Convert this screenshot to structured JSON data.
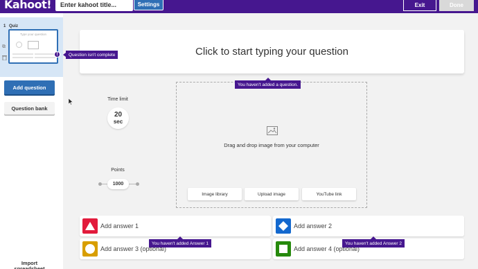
{
  "app": {
    "logo": "Kahoot!",
    "title_placeholder": "Enter kahoot title...",
    "settings_label": "Settings",
    "exit_label": "Exit",
    "done_label": "Done"
  },
  "sidebar": {
    "slot_number": "1",
    "slot_type": "Quiz",
    "thumb_title": "Type your question",
    "incomplete_tooltip": "Question isn't complete",
    "add_question": "Add question",
    "question_bank": "Question bank",
    "import_line1": "Import",
    "import_line2": "spreadsheet"
  },
  "editor": {
    "question_placeholder": "Click to start typing your question",
    "question_tooltip": "You haven't added a question.",
    "time_limit_label": "Time limit",
    "time_limit_value": "20",
    "time_limit_unit": "sec",
    "points_label": "Points",
    "points_value": "1000",
    "media_text": "Drag and drop image from your computer",
    "media_buttons": [
      "Image library",
      "Upload image",
      "YouTube link"
    ]
  },
  "answers": [
    {
      "label": "Add answer 1",
      "color": "#e21b3c",
      "shape": "triangle-icon"
    },
    {
      "label": "Add answer 2",
      "color": "#1368ce",
      "shape": "diamond-icon"
    },
    {
      "label": "Add answer 3 (optional)",
      "color": "#d89e00",
      "shape": "circle-icon"
    },
    {
      "label": "Add answer 4 (optional)",
      "color": "#26890c",
      "shape": "square-icon"
    }
  ],
  "answer_tooltips": [
    "You haven't added Answer 1",
    "You haven't added Answer 2"
  ]
}
